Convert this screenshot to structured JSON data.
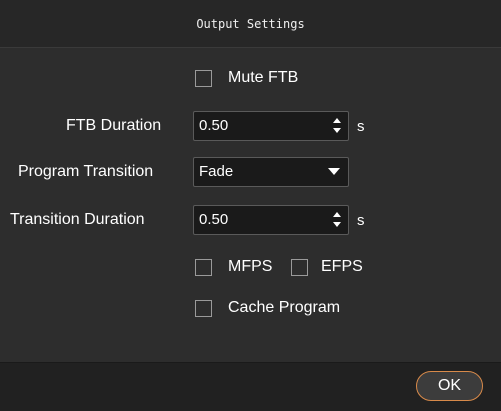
{
  "dialog": {
    "title": "Output Settings"
  },
  "mute_ftb": {
    "label": "Mute FTB",
    "checked": false
  },
  "ftb_duration": {
    "label": "FTB Duration",
    "value": "0.50",
    "unit": "s"
  },
  "program_transition": {
    "label": "Program Transition",
    "selected": "Fade"
  },
  "transition_duration": {
    "label": "Transition Duration",
    "value": "0.50",
    "unit": "s"
  },
  "mfps": {
    "label": "MFPS",
    "checked": false
  },
  "efps": {
    "label": "EFPS",
    "checked": false
  },
  "cache_program": {
    "label": "Cache Program",
    "checked": false
  },
  "footer": {
    "ok_label": "OK"
  },
  "colors": {
    "dialog_bg": "#2d2d2d",
    "input_bg": "#1a1a1a",
    "ok_border_accent": "#d88a4a",
    "text": "#ffffff"
  },
  "icons": {
    "spin_up": "spin-up-arrow",
    "spin_down": "spin-down-arrow",
    "dropdown": "chevron-down"
  }
}
